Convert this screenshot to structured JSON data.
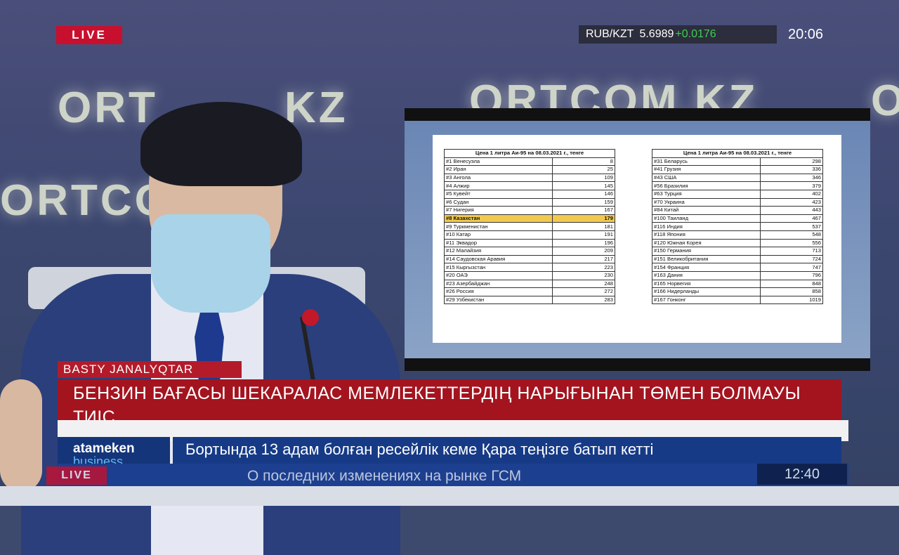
{
  "top": {
    "live_label": "LIVE",
    "ticker_pair": "RUB/KZT",
    "ticker_value": "5.6989",
    "ticker_change": "+0.0176",
    "clock": "20:06"
  },
  "backdrop": {
    "wall_text_1": "ORT",
    "wall_text_2": "KZ",
    "wall_text_3": "ORTCOM.KZ",
    "wall_text_4": "ORTCOM",
    "wall_text_5": "O",
    "wall_text_6": "ORTCOM.KZ"
  },
  "board": {
    "header": "Цена 1 литра Аи-95 на 08.03.2021 г., тенге",
    "left_rows": [
      {
        "country": "#1 Венесуэла",
        "price": "8"
      },
      {
        "country": "#2 Иран",
        "price": "25"
      },
      {
        "country": "#3 Ангола",
        "price": "109"
      },
      {
        "country": "#4 Алжир",
        "price": "145"
      },
      {
        "country": "#5 Кувейт",
        "price": "146"
      },
      {
        "country": "#6 Судан",
        "price": "159"
      },
      {
        "country": "#7 Нигерия",
        "price": "167"
      },
      {
        "country": "#8 Казахстан",
        "price": "179"
      },
      {
        "country": "#9 Туркменистан",
        "price": "181"
      },
      {
        "country": "#10 Катар",
        "price": "191"
      },
      {
        "country": "#11 Эквадор",
        "price": "196"
      },
      {
        "country": "#12 Малайзия",
        "price": "209"
      },
      {
        "country": "#14 Саудовская Аравия",
        "price": "217"
      },
      {
        "country": "#15 Кыргызстан",
        "price": "223"
      },
      {
        "country": "#20 ОАЭ",
        "price": "230"
      },
      {
        "country": "#23 Азербайджан",
        "price": "248"
      },
      {
        "country": "#26 Россия",
        "price": "272"
      },
      {
        "country": "#29 Узбекистан",
        "price": "283"
      }
    ],
    "right_rows": [
      {
        "country": "#31 Беларусь",
        "price": "298"
      },
      {
        "country": "#41 Грузия",
        "price": "336"
      },
      {
        "country": "#43 США",
        "price": "346"
      },
      {
        "country": "#56 Бразилия",
        "price": "379"
      },
      {
        "country": "#63 Турция",
        "price": "402"
      },
      {
        "country": "#70 Украина",
        "price": "423"
      },
      {
        "country": "#84 Китай",
        "price": "443"
      },
      {
        "country": "#100 Таиланд",
        "price": "467"
      },
      {
        "country": "#116 Индия",
        "price": "537"
      },
      {
        "country": "#118 Япония",
        "price": "548"
      },
      {
        "country": "#120 Южная Корея",
        "price": "556"
      },
      {
        "country": "#150 Германия",
        "price": "713"
      },
      {
        "country": "#151 Великобритания",
        "price": "724"
      },
      {
        "country": "#154 Франция",
        "price": "747"
      },
      {
        "country": "#163 Дания",
        "price": "796"
      },
      {
        "country": "#165 Норвегия",
        "price": "848"
      },
      {
        "country": "#166 Нидерланды",
        "price": "858"
      },
      {
        "country": "#167 Гонконг",
        "price": "1019"
      }
    ],
    "highlight_row": 7,
    "highlight_color": "#f2c94c"
  },
  "lower_third": {
    "category": "BASTY JANALYQTAR",
    "headline": "БЕНЗИН БАҒАСЫ ШЕКАРАЛАС МЕМЛЕКЕТТЕРДІҢ НАРЫҒЫНАН ТӨМЕН БОЛМАУЫ ТИІС",
    "logo_line1": "atameken",
    "logo_line2": "business",
    "news_ticker": "Бортында 13 адам болған ресейлік кеме Қара теңізге батып кетті",
    "under_live": "LIVE",
    "under_text": "О последних изменениях на рынке ГСМ",
    "under_clock": "12:40"
  },
  "colors": {
    "live_red": "#c8102e",
    "headline_red": "#a3141f",
    "ticker_green": "#3bd04e",
    "brand_blue": "#163a86"
  }
}
